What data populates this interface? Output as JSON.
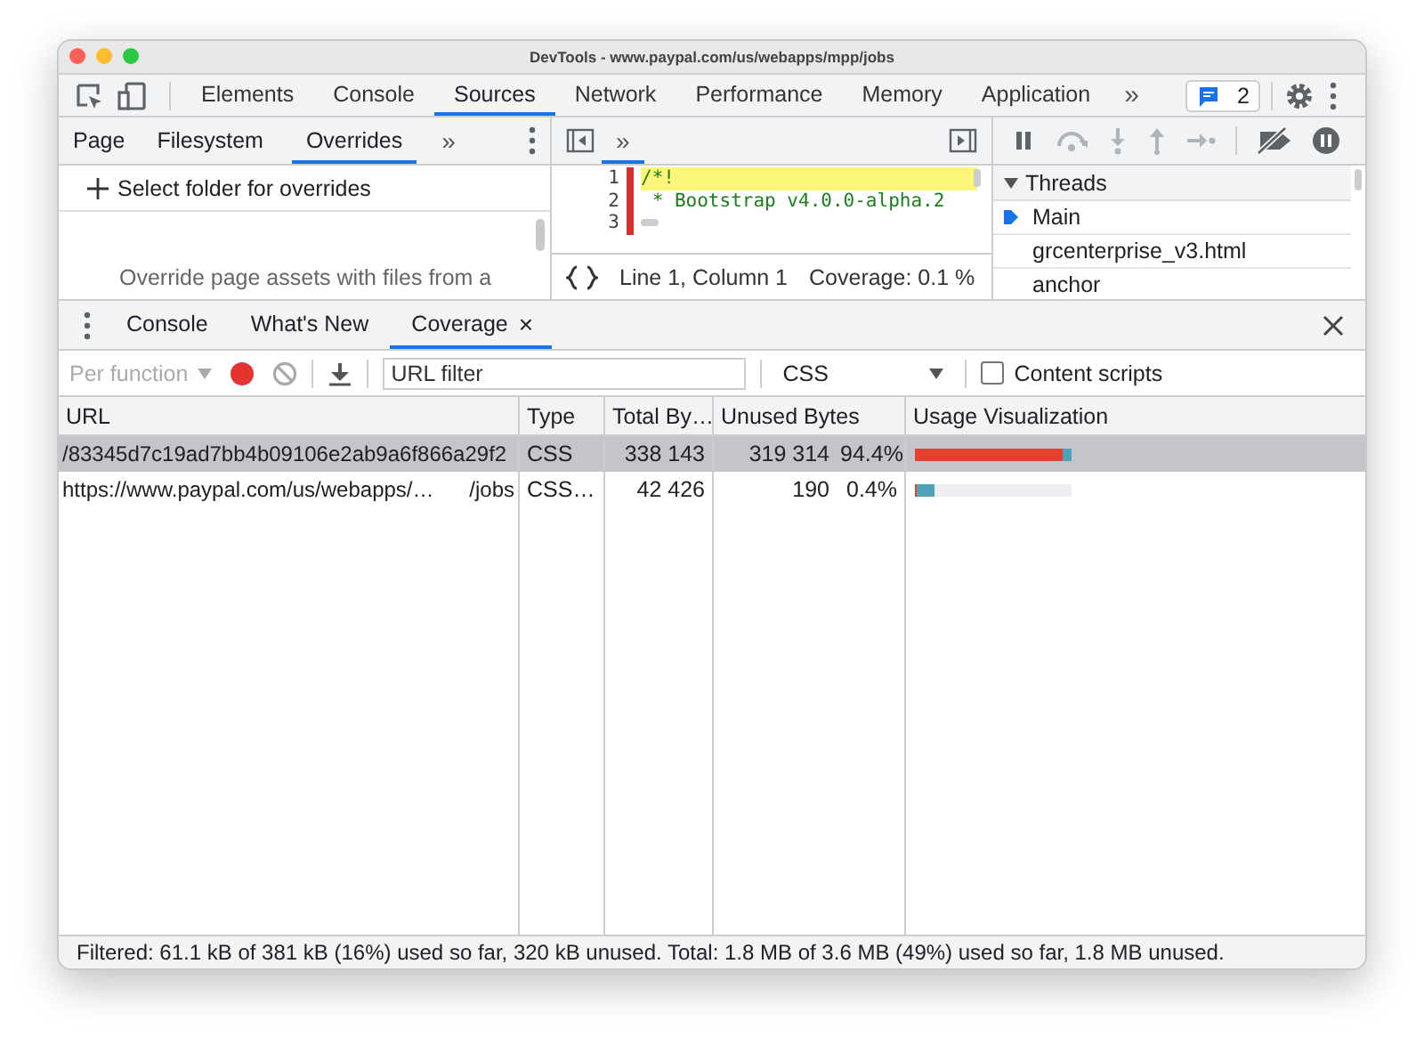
{
  "window": {
    "title": "DevTools - www.paypal.com/us/webapps/mpp/jobs"
  },
  "main_tabs": [
    {
      "label": "Elements",
      "selected": false
    },
    {
      "label": "Console",
      "selected": false
    },
    {
      "label": "Sources",
      "selected": true
    },
    {
      "label": "Network",
      "selected": false
    },
    {
      "label": "Performance",
      "selected": false
    },
    {
      "label": "Memory",
      "selected": false
    },
    {
      "label": "Application",
      "selected": false
    }
  ],
  "more_tabs": "»",
  "issues_badge": "2",
  "navigator": {
    "tabs": [
      {
        "label": "Page",
        "selected": false
      },
      {
        "label": "Filesystem",
        "selected": false
      },
      {
        "label": "Overrides",
        "selected": true
      }
    ],
    "more": "»",
    "action": "Select folder for overrides",
    "message": "Override page assets with files from a"
  },
  "editor": {
    "more": "»",
    "lines": [
      {
        "number": "1",
        "text": "/*!",
        "highlighted": true
      },
      {
        "number": "2",
        "text": " * Bootstrap v4.0.0-alpha.2",
        "highlighted": false
      },
      {
        "number": "3",
        "highlighted": false
      }
    ],
    "position": "Line 1, Column 1",
    "coverage": "Coverage: 0.1 %"
  },
  "debugger": {
    "threads_title": "Threads",
    "threads": [
      {
        "name": "Main",
        "selected": true
      },
      {
        "name": "grcenterprise_v3.html",
        "selected": false
      },
      {
        "name": "anchor",
        "selected": false
      }
    ]
  },
  "drawer": {
    "tabs": [
      {
        "label": "Console",
        "selected": false,
        "closable": false
      },
      {
        "label": "What's New",
        "selected": false,
        "closable": false
      },
      {
        "label": "Coverage",
        "selected": true,
        "closable": true
      }
    ],
    "close_tab": "×"
  },
  "toolbar": {
    "mode": "Per function",
    "url_filter_placeholder": "URL filter",
    "type_filter": "CSS",
    "content_scripts": {
      "label": "Content scripts",
      "checked": false
    }
  },
  "table": {
    "columns": [
      "URL",
      "Type",
      "Total By…",
      "Unused Bytes",
      "Usage Visualization"
    ],
    "rows": [
      {
        "url": "/83345d7c19ad7bb4b09106e2ab9a6f866a29f2",
        "type": "CSS",
        "total": "338 143",
        "unused": "319 314",
        "unused_pct": "94.4%",
        "selected": true,
        "bar": {
          "level": 1
        },
        "unused_bar": {
          "level": 0.944
        }
      },
      {
        "url": "https://www.paypal.com/us/webapps/…",
        "url_suffix": "/jobs",
        "type": "CSS…",
        "total": "42 426",
        "unused": "190",
        "unused_pct": "0.4%",
        "selected": false,
        "bar": {
          "level": 0.13
        },
        "unused_bar": {
          "level": 0.1
        }
      }
    ]
  },
  "status_bar": "Filtered: 61.1 kB of 381 kB (16%) used so far, 320 kB unused. Total: 1.8 MB of 3.6 MB (49%) used so far, 1.8 MB unused."
}
